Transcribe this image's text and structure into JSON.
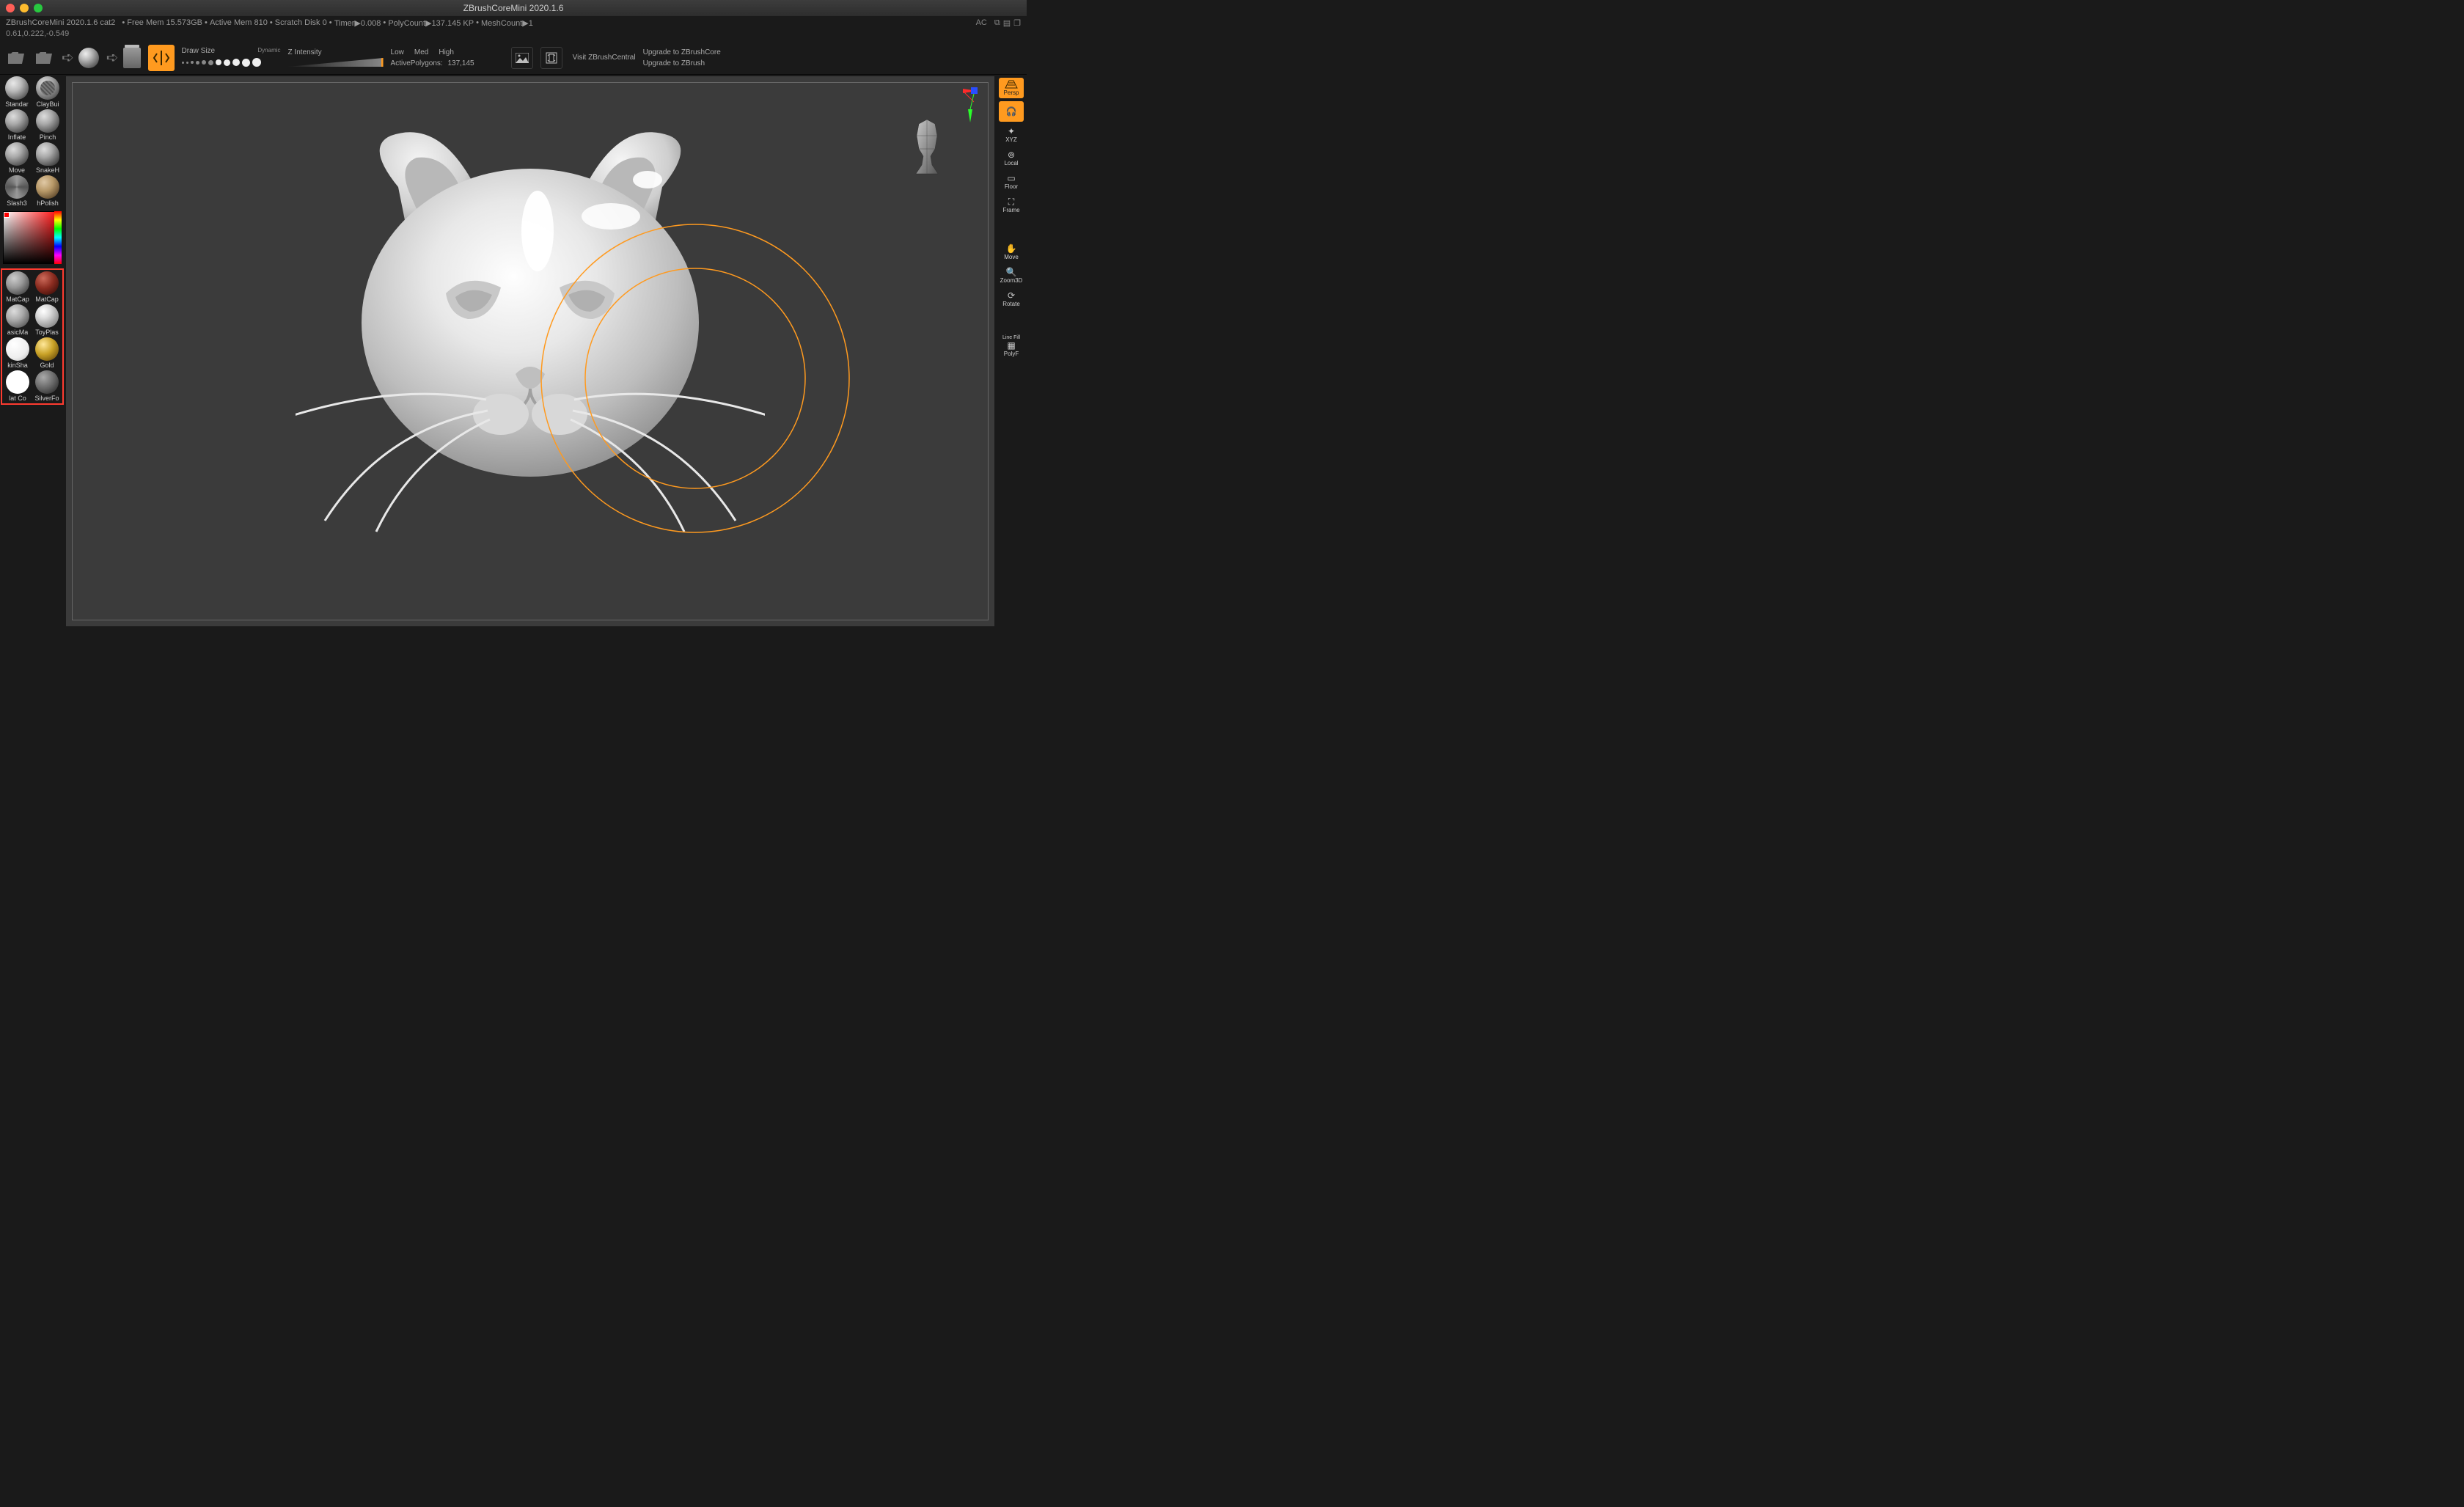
{
  "titlebar": {
    "title": "ZBrushCoreMini 2020.1.6"
  },
  "status": {
    "project": "ZBrushCoreMini 2020.1.6 cat2",
    "free_mem": "Free Mem 15.573GB",
    "active_mem": "Active Mem 810",
    "scratch": "Scratch Disk 0",
    "timer": "Timer▶0.008",
    "polycount": "PolyCount▶137.145 KP",
    "meshcount": "MeshCount▶1",
    "ac": "AC"
  },
  "coords": "0.61,0.222,-0.549",
  "toolbar": {
    "draw_size_label": "Draw Size",
    "dynamic_label": "Dynamic",
    "z_intensity_label": "Z Intensity",
    "lmh": {
      "low": "Low",
      "med": "Med",
      "high": "High"
    },
    "active_polys_label": "ActivePolygons:",
    "active_polys_value": "137,145",
    "visit_central": "Visit ZBrushCentral",
    "upgrade_core": "Upgrade to ZBrushCore",
    "upgrade_full": "Upgrade to ZBrush"
  },
  "brushes": [
    {
      "name": "Standar"
    },
    {
      "name": "ClayBui"
    },
    {
      "name": "Inflate"
    },
    {
      "name": "Pinch"
    },
    {
      "name": "Move"
    },
    {
      "name": "SnakeH"
    },
    {
      "name": "Slash3"
    },
    {
      "name": "hPolish"
    }
  ],
  "materials": [
    {
      "name": "MatCap",
      "bg": "radial-gradient(circle at 35% 30%, #ccc 0%, #999 40%, #444 85%)"
    },
    {
      "name": "MatCap",
      "bg": "radial-gradient(circle at 35% 30%, #cc6a5a 0%, #8b2c20 45%, #3a0d08 90%)"
    },
    {
      "name": "asicMa",
      "bg": "radial-gradient(circle at 35% 30%, #ddd 0%, #aaa 40%, #555 85%)"
    },
    {
      "name": "ToyPlas",
      "bg": "radial-gradient(circle at 35% 30%, #fff 0%, #ddd 30%, #888 80%)"
    },
    {
      "name": "kinSha",
      "bg": "radial-gradient(circle at 35% 30%, #fff 0%, #eee 60%, #bbb 95%)"
    },
    {
      "name": "Gold",
      "bg": "radial-gradient(circle at 35% 30%, #ffe89a 0%, #c9a227 45%, #5a3e05 95%)"
    },
    {
      "name": "lat Co",
      "bg": "radial-gradient(circle at 35% 30%, #fff 0%, #fff 95%)"
    },
    {
      "name": "SilverFo",
      "bg": "radial-gradient(circle at 35% 30%, #aaa 0%, #666 50%, #222 95%)"
    }
  ],
  "right_tools": {
    "persp": "Persp",
    "xyz": "XYZ",
    "local": "Local",
    "floor": "Floor",
    "frame": "Frame",
    "move": "Move",
    "zoom3d": "Zoom3D",
    "rotate": "Rotate",
    "linefill": "Line Fill",
    "polyf": "PolyF"
  }
}
